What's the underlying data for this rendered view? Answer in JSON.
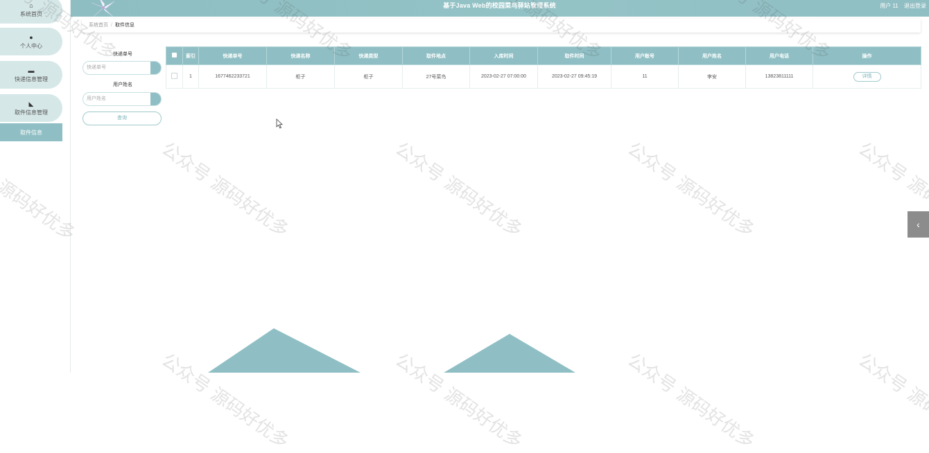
{
  "header": {
    "title": "基于Java Web的校园菜鸟驿站管理系统",
    "user_label": "用户 11",
    "logout_label": "退出登录"
  },
  "sidebar": {
    "items": [
      {
        "icon": "home-icon",
        "label": "系统首页"
      },
      {
        "icon": "user-icon",
        "label": "个人中心"
      },
      {
        "icon": "package-icon",
        "label": "快递信息管理"
      },
      {
        "icon": "pickup-icon",
        "label": "取件信息管理"
      }
    ],
    "sub_item": "取件信息"
  },
  "breadcrumb": {
    "home": "系统首页",
    "separator": "/",
    "current": "取件信息"
  },
  "search": {
    "field1_label": "快递单号",
    "field1_placeholder": "快递单号",
    "field2_label": "用户姓名",
    "field2_placeholder": "用户姓名",
    "button_label": "查询"
  },
  "table": {
    "headers": [
      "索引",
      "快递单号",
      "快递名称",
      "快递类型",
      "取件地点",
      "入库时间",
      "取件时间",
      "用户账号",
      "用户姓名",
      "用户电话",
      "操作"
    ],
    "rows": [
      [
        "1",
        "1677462233721",
        "柜子",
        "柜子",
        "27号菜鸟",
        "2023-02-27 07:00:00",
        "2023-02-27 09:45:19",
        "11",
        "李安",
        "13823811111"
      ]
    ],
    "action_label": "详情"
  },
  "watermark": "公众号 源码好优多",
  "colors": {
    "accent": "#8fbfc4",
    "sidebar_item_bg": "#d6e7e8",
    "toggle_bg": "#8c8c8c"
  }
}
